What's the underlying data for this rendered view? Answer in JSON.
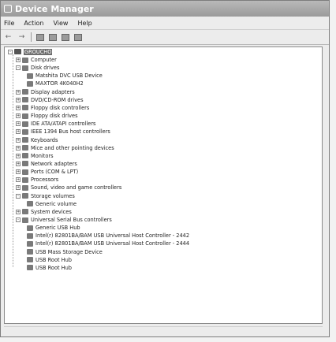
{
  "window": {
    "title": "Device Manager"
  },
  "menu": [
    "File",
    "Action",
    "View",
    "Help"
  ],
  "toolbar": [
    {
      "name": "back-icon",
      "glyph": "←"
    },
    {
      "name": "forward-icon",
      "glyph": "→"
    },
    {
      "name": "properties-icon",
      "glyph": ""
    },
    {
      "name": "print-icon",
      "glyph": ""
    },
    {
      "name": "update-driver-icon",
      "glyph": ""
    },
    {
      "name": "scan-hardware-icon",
      "glyph": ""
    }
  ],
  "tree": {
    "root": "GROUCHO",
    "nodes": [
      {
        "label": "Computer",
        "level": 1,
        "expander": "+"
      },
      {
        "label": "Disk drives",
        "level": 1,
        "expander": "-"
      },
      {
        "label": "Matshita DVC USB Device",
        "level": 2,
        "expander": ""
      },
      {
        "label": "MAXTOR 4K040H2",
        "level": 2,
        "expander": ""
      },
      {
        "label": "Display adapters",
        "level": 1,
        "expander": "+"
      },
      {
        "label": "DVD/CD-ROM drives",
        "level": 1,
        "expander": "+"
      },
      {
        "label": "Floppy disk controllers",
        "level": 1,
        "expander": "+"
      },
      {
        "label": "Floppy disk drives",
        "level": 1,
        "expander": "+"
      },
      {
        "label": "IDE ATA/ATAPI controllers",
        "level": 1,
        "expander": "+"
      },
      {
        "label": "IEEE 1394 Bus host controllers",
        "level": 1,
        "expander": "+"
      },
      {
        "label": "Keyboards",
        "level": 1,
        "expander": "+"
      },
      {
        "label": "Mice and other pointing devices",
        "level": 1,
        "expander": "+"
      },
      {
        "label": "Monitors",
        "level": 1,
        "expander": "+"
      },
      {
        "label": "Network adapters",
        "level": 1,
        "expander": "+"
      },
      {
        "label": "Ports (COM & LPT)",
        "level": 1,
        "expander": "+"
      },
      {
        "label": "Processors",
        "level": 1,
        "expander": "+"
      },
      {
        "label": "Sound, video and game controllers",
        "level": 1,
        "expander": "+"
      },
      {
        "label": "Storage volumes",
        "level": 1,
        "expander": "-"
      },
      {
        "label": "Generic volume",
        "level": 2,
        "expander": ""
      },
      {
        "label": "System devices",
        "level": 1,
        "expander": "+"
      },
      {
        "label": "Universal Serial Bus controllers",
        "level": 1,
        "expander": "-"
      },
      {
        "label": "Generic USB Hub",
        "level": 2,
        "expander": ""
      },
      {
        "label": "Intel(r) 82801BA/BAM USB Universal Host Controller - 2442",
        "level": 2,
        "expander": ""
      },
      {
        "label": "Intel(r) 82801BA/BAM USB Universal Host Controller - 2444",
        "level": 2,
        "expander": ""
      },
      {
        "label": "USB Mass Storage Device",
        "level": 2,
        "expander": ""
      },
      {
        "label": "USB Root Hub",
        "level": 2,
        "expander": ""
      },
      {
        "label": "USB Root Hub",
        "level": 2,
        "expander": ""
      }
    ]
  }
}
